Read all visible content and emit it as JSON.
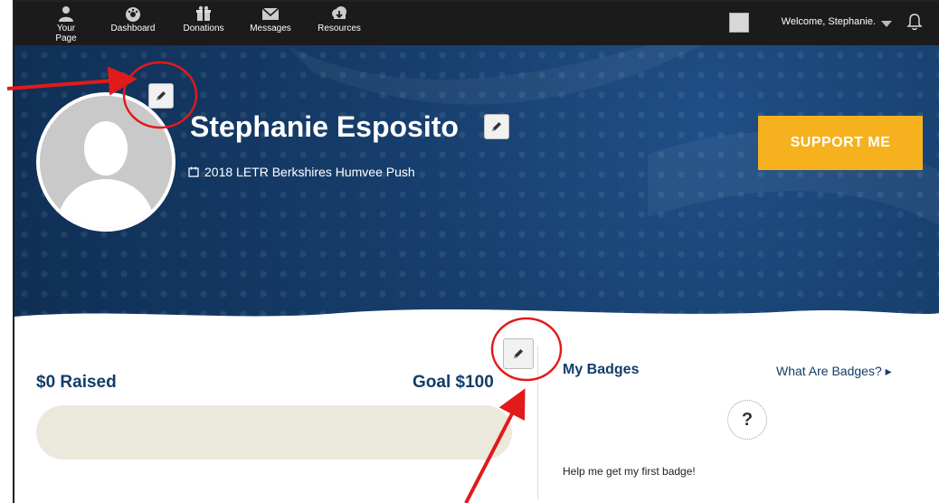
{
  "nav": {
    "items": [
      {
        "label": "Your Page",
        "icon": "person-icon"
      },
      {
        "label": "Dashboard",
        "icon": "gauge-icon"
      },
      {
        "label": "Donations",
        "icon": "gift-icon"
      },
      {
        "label": "Messages",
        "icon": "envelope-icon"
      },
      {
        "label": "Resources",
        "icon": "cloud-download-icon"
      }
    ],
    "welcome": "Welcome, Stephanie."
  },
  "hero": {
    "name": "Stephanie Esposito",
    "event": "2018 LETR Berkshires Humvee Push",
    "support_label": "SUPPORT ME"
  },
  "fundraising": {
    "raised": "$0 Raised",
    "goal": "Goal $100",
    "progress": 0
  },
  "badges": {
    "title": "My Badges",
    "link": "What Are Badges?",
    "placeholder": "?",
    "help": "Help me get my first badge!"
  },
  "colors": {
    "nav_bg": "#1b1b1b",
    "hero_blue": "#163d6b",
    "accent": "#f5b21e",
    "annotation": "#e21a1a"
  }
}
